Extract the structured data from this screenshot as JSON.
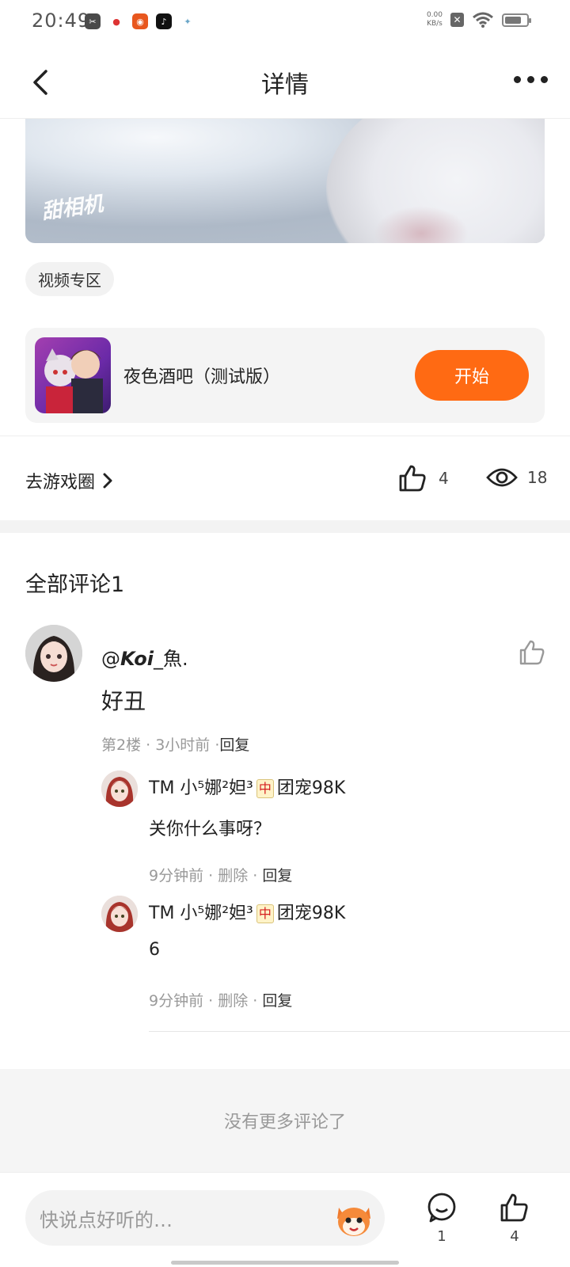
{
  "status_bar": {
    "time": "20:49",
    "apps": [
      "scissors-app-icon",
      "balloon-app-icon",
      "pumpkin-app-icon",
      "tiktok-app-icon",
      "sparkle-app-icon"
    ],
    "net_speed_value": "0.00",
    "net_speed_unit": "KB/s",
    "battery_level": 0.75
  },
  "nav": {
    "title": "详情"
  },
  "media": {
    "watermark": "甜相机"
  },
  "tag": {
    "label": "视频专区"
  },
  "game": {
    "title": "夜色酒吧（测试版）",
    "start_label": "开始"
  },
  "stats": {
    "go_circle_label": "去游戏圈",
    "likes": "4",
    "views": "18"
  },
  "comments": {
    "title": "全部评论1",
    "main": {
      "author_prefix": "@",
      "author_name": "Koi",
      "author_suffix": "_魚.",
      "text": "好丑",
      "floor": "第2楼",
      "time": "3小时前",
      "reply_label": "回复"
    },
    "replies": [
      {
        "author_pre": "TM",
        "author_mid": "小⁵娜²妲³",
        "mahjong": "中",
        "author_post": "团宠98K",
        "text": "关你什么事呀？",
        "time": "9分钟前",
        "delete_label": "删除",
        "reply_label": "回复"
      },
      {
        "author_pre": "TM",
        "author_mid": "小⁵娜²妲³",
        "mahjong": "中",
        "author_post": "团宠98K",
        "text": "6",
        "time": "9分钟前",
        "delete_label": "删除",
        "reply_label": "回复"
      }
    ],
    "no_more": "没有更多评论了"
  },
  "bottom_bar": {
    "input_placeholder": "快说点好听的…",
    "comment_count": "1",
    "like_count": "4"
  },
  "colors": {
    "accent": "#ff6a13",
    "divider": "#f3f3f3"
  }
}
